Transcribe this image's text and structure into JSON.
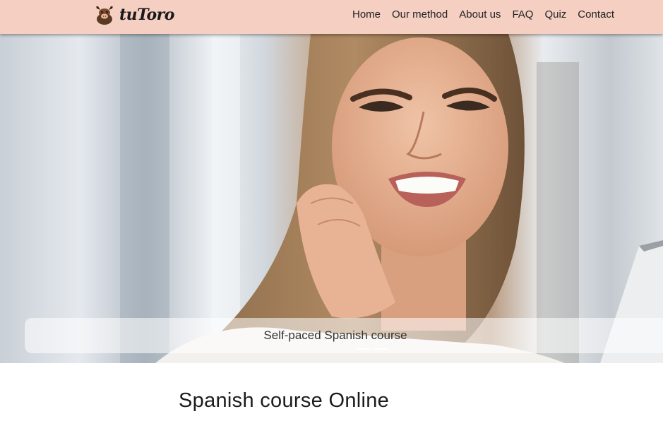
{
  "brand": {
    "name": "tuToro",
    "logo_icon": "bull-mascot-icon"
  },
  "nav": {
    "items": [
      "Home",
      "Our method",
      "About us",
      "FAQ",
      "Quiz",
      "Contact"
    ]
  },
  "hero": {
    "caption": "Self-paced Spanish course",
    "image": "smiling-woman-on-phone-photo"
  },
  "main": {
    "title": "Spanish course Online"
  },
  "colors": {
    "navbar_bg": "#f5cfc2",
    "text": "#222222"
  }
}
